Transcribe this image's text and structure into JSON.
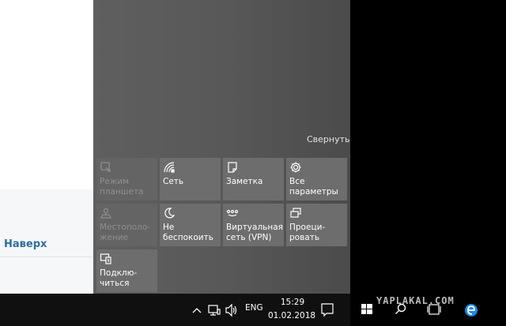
{
  "browser": {
    "back_to_top": "Наверх"
  },
  "action_center": {
    "collapse_label": "Свернуть",
    "tiles": [
      {
        "label": "Режим\nпланшета",
        "icon": "tablet-mode-icon",
        "enabled": false
      },
      {
        "label": "Сеть",
        "icon": "network-icon",
        "enabled": true
      },
      {
        "label": "Заметка",
        "icon": "note-icon",
        "enabled": true
      },
      {
        "label": "Все\nпараметры",
        "icon": "gear-icon",
        "enabled": true
      },
      {
        "label": "Местополо-\nжение",
        "icon": "location-icon",
        "enabled": false
      },
      {
        "label": "Не\nбеспокоить",
        "icon": "moon-icon",
        "enabled": true
      },
      {
        "label": "Виртуальная\nсеть (VPN)",
        "icon": "vpn-icon",
        "enabled": true
      },
      {
        "label": "Проеци-\nровать",
        "icon": "project-icon",
        "enabled": true
      },
      {
        "label": "Подклю-\nчиться",
        "icon": "connect-icon",
        "enabled": true
      }
    ]
  },
  "taskbar": {
    "language": "ENG",
    "time": "15:29",
    "date": "01.02.2018",
    "watermark": "YAPLAKAL.COM",
    "icons": [
      "chevron-up-icon",
      "network-icon",
      "volume-icon",
      "notification-icon",
      "windows-start-icon",
      "search-icon",
      "task-view-icon",
      "edge-icon"
    ]
  },
  "colors": {
    "tile": "#6d6d6d",
    "tile_disabled": "#646464",
    "action_center_bg": "#5a5a5a",
    "link": "#2f6f9c"
  }
}
